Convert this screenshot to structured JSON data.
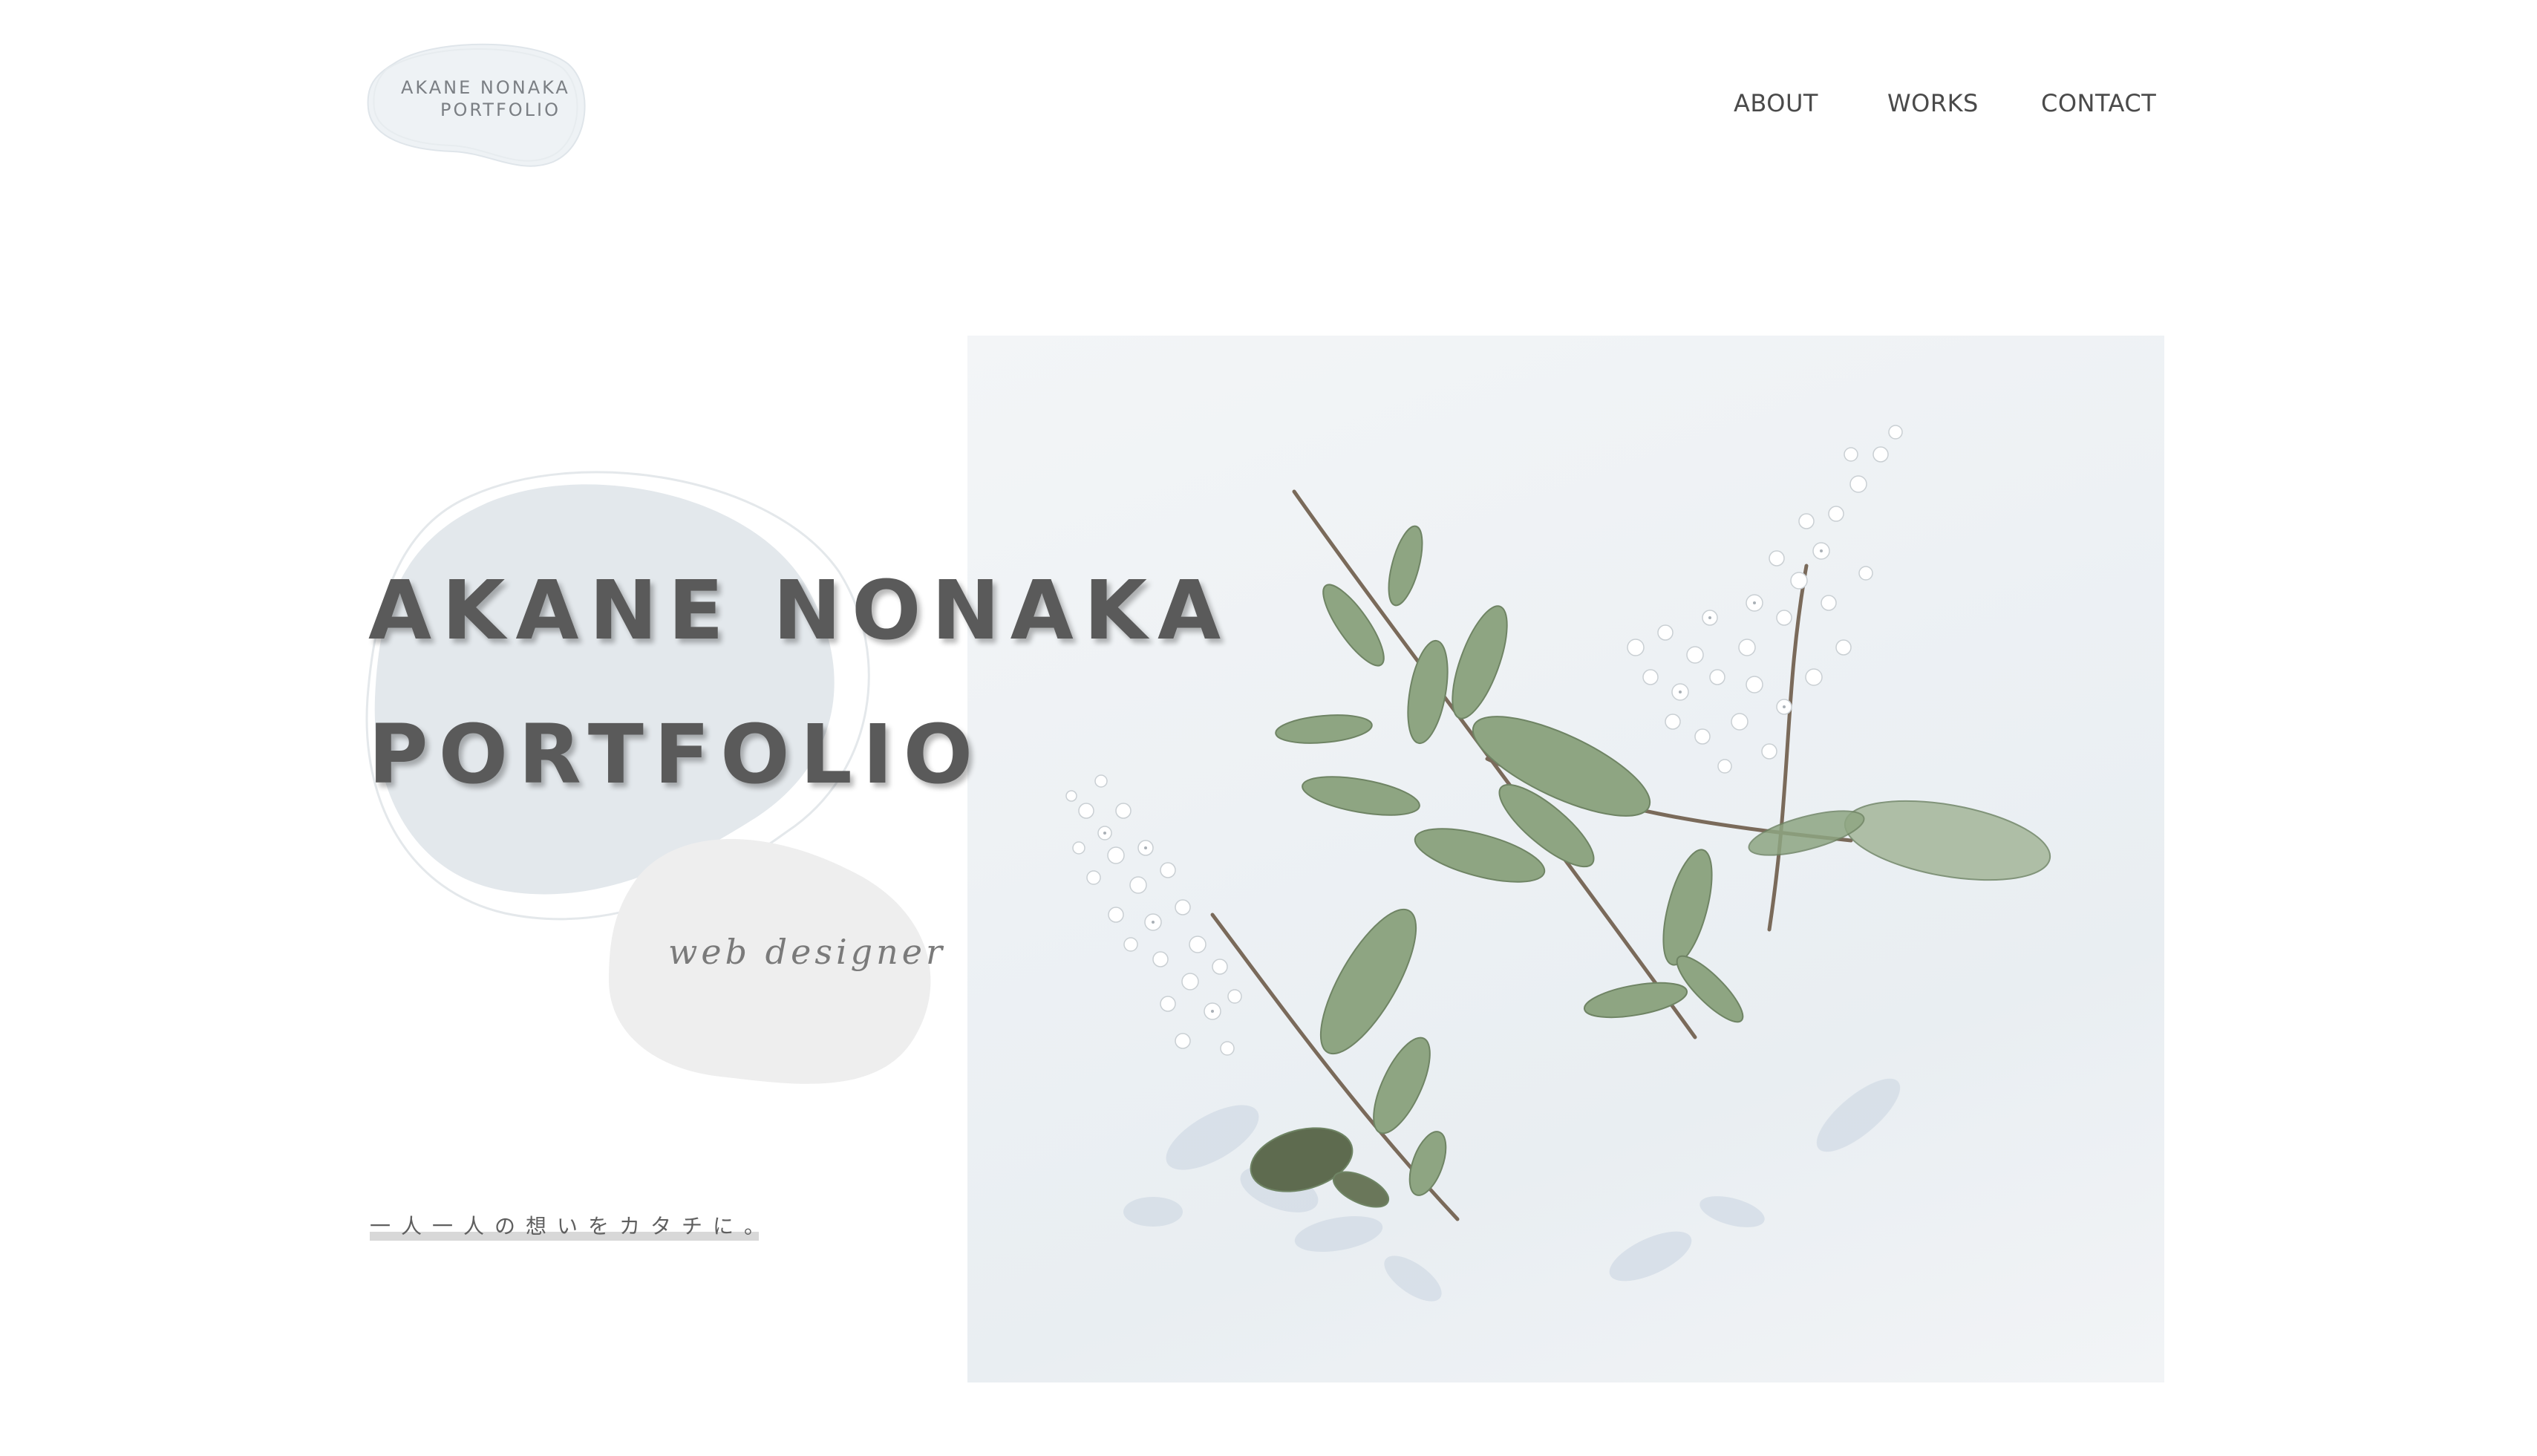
{
  "header": {
    "logo": {
      "line1": "AKANE NONAKA",
      "line2": "PORTFOLIO"
    },
    "nav": [
      {
        "label": "ABOUT"
      },
      {
        "label": "WORKS"
      },
      {
        "label": "CONTACT"
      }
    ]
  },
  "hero": {
    "title_line1": "AKANE NONAKA",
    "title_line2": "PORTFOLIO",
    "subtitle": "web designer",
    "tagline": "一人一人の想いをカタチに。",
    "image": {
      "description_icon": "flower-branch-photo"
    }
  },
  "colors": {
    "background": "#ffffff",
    "text_primary": "#5a5a5a",
    "nav_text": "#4a4a4a",
    "blob_blue": "#e3e8ec",
    "blob_grey": "#eeeeee",
    "leaf_green": "#8aa07c",
    "tagline_underline": "#d8d8d8"
  }
}
